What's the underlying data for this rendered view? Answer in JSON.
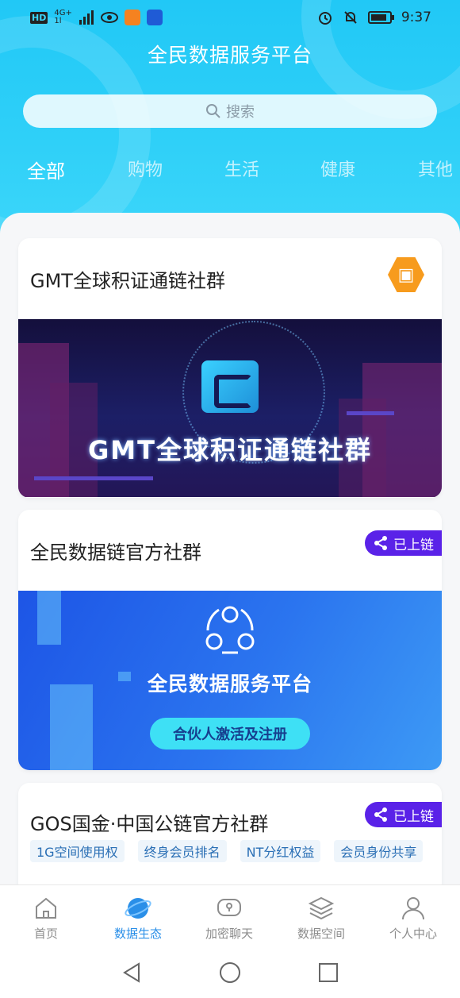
{
  "status_bar": {
    "network_tag": "HD",
    "network_type": "4G+",
    "network_sub": "1l",
    "time": "9:37"
  },
  "app": {
    "title": "全民数据服务平台",
    "search_placeholder": "搜索"
  },
  "tabs": [
    {
      "label": "全部",
      "active": true
    },
    {
      "label": "购物",
      "active": false
    },
    {
      "label": "生活",
      "active": false
    },
    {
      "label": "健康",
      "active": false
    },
    {
      "label": "其他",
      "active": false
    }
  ],
  "cards": [
    {
      "title": "GMT全球积证通链社群",
      "badge_icon": "hexagon-app-icon",
      "banner_text": "GMT全球积证通链社群"
    },
    {
      "title": "全民数据链官方社群",
      "chain_badge": "已上链",
      "banner_title": "全民数据服务平台",
      "banner_button": "合伙人激活及注册"
    },
    {
      "title": "GOS国金·中国公链官方社群",
      "chain_badge": "已上链",
      "tags": [
        "1G空间使用权",
        "终身会员排名",
        "NT分红权益",
        "会员身份共享"
      ]
    }
  ],
  "bottom_nav": [
    {
      "label": "首页",
      "icon": "home-icon",
      "active": false
    },
    {
      "label": "数据生态",
      "icon": "planet-icon",
      "active": true
    },
    {
      "label": "加密聊天",
      "icon": "chat-lock-icon",
      "active": false
    },
    {
      "label": "数据空间",
      "icon": "layers-icon",
      "active": false
    },
    {
      "label": "个人中心",
      "icon": "user-icon",
      "active": false
    }
  ],
  "colors": {
    "header": "#21c8f6",
    "active_nav": "#2a8fe8",
    "chain_badge": "#5a22e8",
    "badge_orange": "#f79b1d"
  }
}
